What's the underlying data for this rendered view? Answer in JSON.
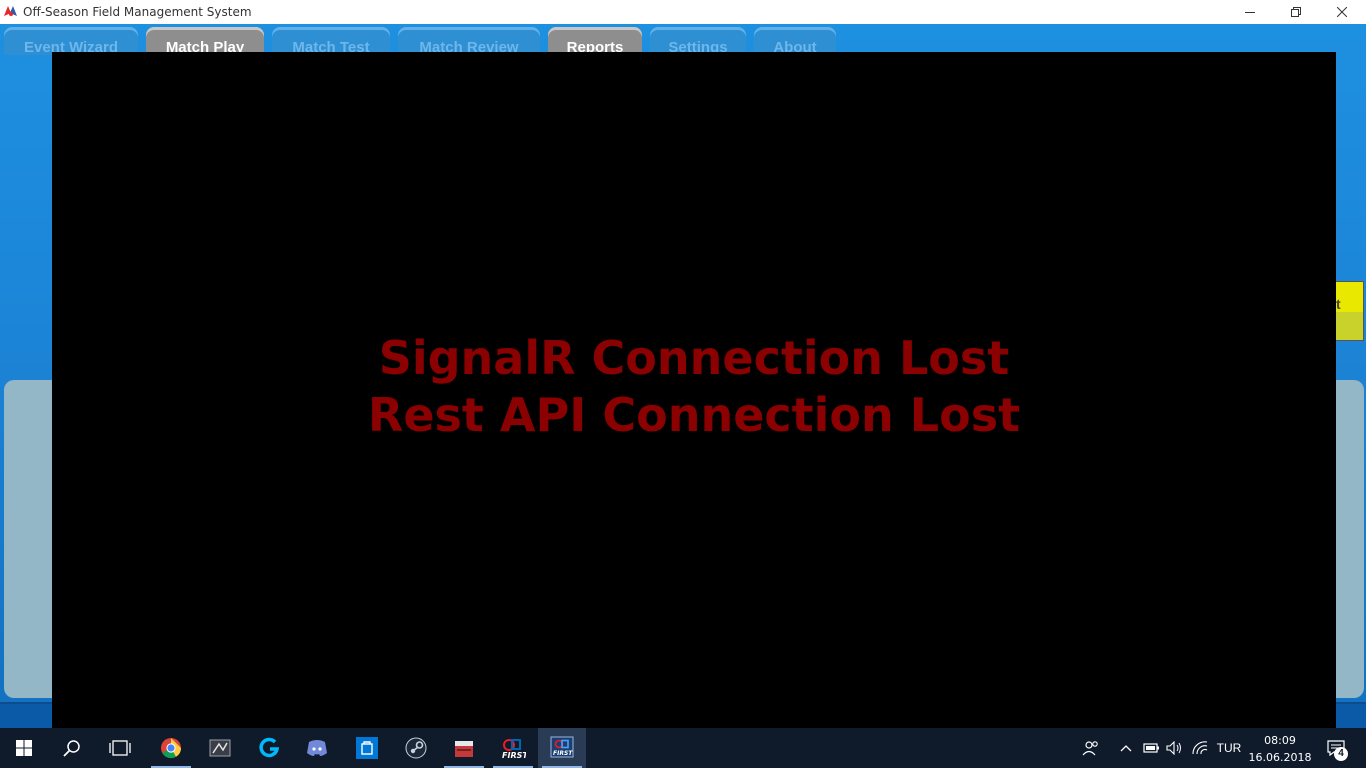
{
  "window": {
    "title": "Off-Season Field Management System",
    "controls": [
      "minimize-icon",
      "restore-icon",
      "close-icon"
    ]
  },
  "tabs": [
    {
      "label": "Event Wizard",
      "active": false
    },
    {
      "label": "Match Play",
      "active": true
    },
    {
      "label": "Match Test",
      "active": false
    },
    {
      "label": "Match Review",
      "active": false
    },
    {
      "label": "Reports",
      "active": true
    },
    {
      "label": "Settings",
      "active": false
    },
    {
      "label": "About",
      "active": false
    }
  ],
  "side_button": {
    "label": "t",
    "color": "#e8e800"
  },
  "overlay": {
    "line1": "SignalR Connection Lost",
    "line2": "Rest API Connection Lost",
    "text_color": "#8b0000",
    "background": "#000000"
  },
  "taskbar": {
    "apps": [
      "windows-start-icon",
      "search-icon",
      "task-view-icon",
      "chrome-icon",
      "app-icon",
      "logitech-icon",
      "discord-icon",
      "store-icon",
      "steam-icon",
      "toolbox-icon",
      "first-icon",
      "first-fms-icon"
    ],
    "language": "TUR",
    "time": "08:09",
    "date": "16.06.2018",
    "notification_count": "4"
  }
}
